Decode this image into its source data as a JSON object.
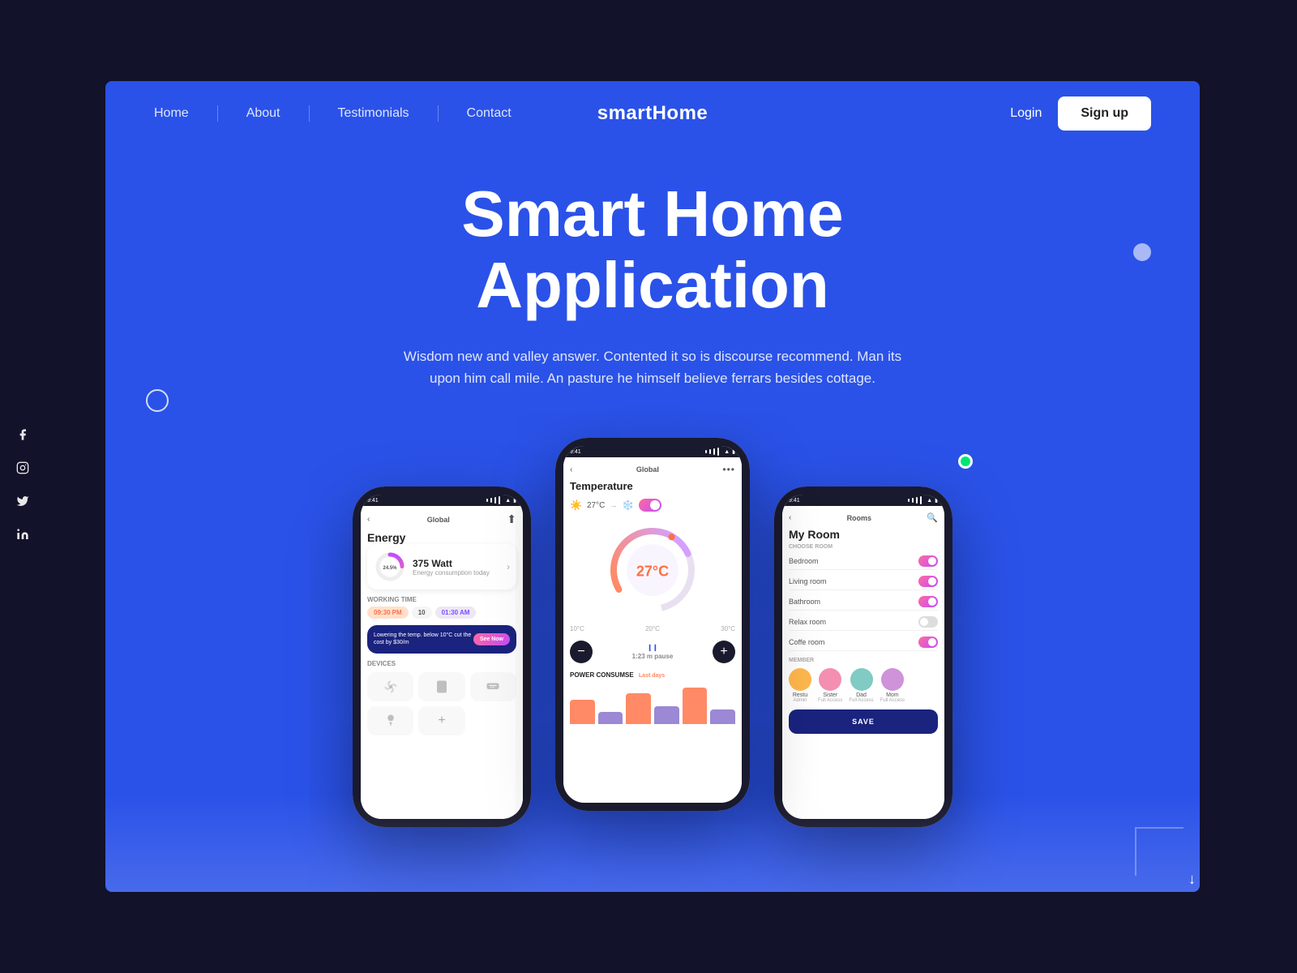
{
  "meta": {
    "bg_dark": "#12122a",
    "bg_blue": "#2a52e8"
  },
  "navbar": {
    "links": [
      "Home",
      "About",
      "Testimonials",
      "Contact"
    ],
    "brand": "smartHome",
    "login_label": "Login",
    "signup_label": "Sign up"
  },
  "hero": {
    "title_line1": "Smart Home",
    "title_line2": "Application",
    "subtitle": "Wisdom new and valley answer. Contented it so is discourse recommend. Man its upon him call mile. An pasture he himself believe ferrars besides cottage."
  },
  "phone1": {
    "time": "9:41",
    "nav_label": "Global",
    "title": "Energy",
    "watt_value": "375 Watt",
    "watt_sub": "Energy consumption today",
    "watt_percent": "24.5%",
    "working_time_label": "WORKING TIME",
    "time1": "09:30 PM",
    "time_mid": "10",
    "time2": "01:30 AM",
    "promo_text": "Lowering the temp. below 10°C cut the cost by $30/m",
    "promo_btn": "See Now",
    "devices_label": "DEVICES"
  },
  "phone2": {
    "time": "9:41",
    "nav_label": "Global",
    "title": "Temperature",
    "temp_current": "27°C",
    "temp_icon_value": "27°C",
    "temp_low": "10°C",
    "temp_high": "30°C",
    "temp_top": "20°C",
    "pause_label": "1:23 m pause",
    "power_label": "POWER CONSUMSE",
    "last_days": "Last days"
  },
  "phone3": {
    "time": "9:41",
    "nav_label": "Rooms",
    "title": "My Room",
    "choose_room_label": "CHOOSE ROOM",
    "rooms": [
      {
        "name": "Bedroom",
        "on": true
      },
      {
        "name": "Living room",
        "on": true
      },
      {
        "name": "Bathroom",
        "on": true
      },
      {
        "name": "Relax room",
        "on": false
      },
      {
        "name": "Coffe room",
        "on": true
      }
    ],
    "member_label": "MEMBER",
    "members": [
      {
        "name": "Restu",
        "role": "Admin",
        "color": "#ffb74d"
      },
      {
        "name": "Sister",
        "role": "Full Access",
        "color": "#f48fb1"
      },
      {
        "name": "Dad",
        "role": "Full Access",
        "color": "#80cbc4"
      },
      {
        "name": "Mom",
        "role": "Full Access",
        "color": "#ce93d8"
      }
    ],
    "save_label": "SAVE"
  },
  "social": {
    "icons": [
      "f",
      "◯",
      "✦",
      "in"
    ]
  }
}
